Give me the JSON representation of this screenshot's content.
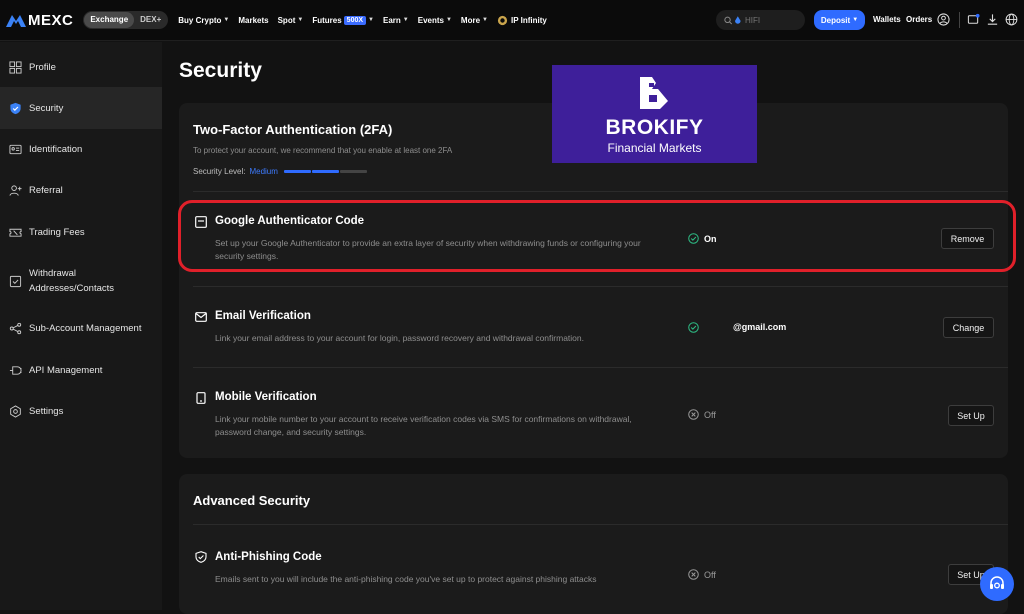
{
  "topbar": {
    "logo_text": "MEXC",
    "modes": [
      "Exchange",
      "DEX+"
    ],
    "nav": {
      "buy_crypto": "Buy Crypto",
      "markets": "Markets",
      "spot": "Spot",
      "futures": "Futures",
      "futures_badge": "500X",
      "earn": "Earn",
      "events": "Events",
      "more": "More",
      "ip_infinity": "IP Infinity"
    },
    "search_placeholder": "HIFI",
    "deposit_label": "Deposit",
    "wallets_label": "Wallets",
    "orders_label": "Orders"
  },
  "sidebar": {
    "items": [
      {
        "label": "Profile",
        "icon": "profile-icon"
      },
      {
        "label": "Security",
        "icon": "shield-icon"
      },
      {
        "label": "Identification",
        "icon": "id-card-icon"
      },
      {
        "label": "Referral",
        "icon": "referral-icon"
      },
      {
        "label": "Trading Fees",
        "icon": "ticket-icon"
      },
      {
        "label": "Withdrawal Addresses/Contacts",
        "icon": "address-book-icon"
      },
      {
        "label": "Sub-Account Management",
        "icon": "sub-account-icon"
      },
      {
        "label": "API Management",
        "icon": "api-icon"
      },
      {
        "label": "Settings",
        "icon": "gear-icon"
      }
    ]
  },
  "page": {
    "title": "Security"
  },
  "twofa": {
    "title": "Two-Factor Authentication (2FA)",
    "description": "To protect your account, we recommend that you enable at least one 2FA",
    "security_level_label": "Security Level:",
    "security_level_value": "Medium",
    "security_level_fraction": 0.67,
    "rows": {
      "google": {
        "title": "Google Authenticator Code",
        "description": "Set up your Google Authenticator to provide an extra layer of security when withdrawing funds or configuring your security settings.",
        "status": "On",
        "action": "Remove"
      },
      "email": {
        "title": "Email Verification",
        "description": "Link your email address to your account for login, password recovery and withdrawal confirmation.",
        "value": "@gmail.com",
        "action": "Change"
      },
      "mobile": {
        "title": "Mobile Verification",
        "description": "Link your mobile number to your account to receive verification codes via SMS for confirmations on withdrawal, password change, and security settings.",
        "status": "Off",
        "action": "Set Up"
      }
    }
  },
  "advanced": {
    "title": "Advanced Security",
    "anti_phishing": {
      "title": "Anti-Phishing Code",
      "description": "Emails sent to you will include the anti-phishing code you've set up to protect against phishing attacks",
      "status": "Off",
      "action": "Set Up"
    }
  },
  "overlay": {
    "brand_name": "BROKIFY",
    "brand_sub": "Financial Markets"
  },
  "colors": {
    "accent_blue": "#2f6bff",
    "status_green": "#2ebd85",
    "highlight_red": "#e0202a",
    "brand_purple": "#3e1f9a"
  }
}
